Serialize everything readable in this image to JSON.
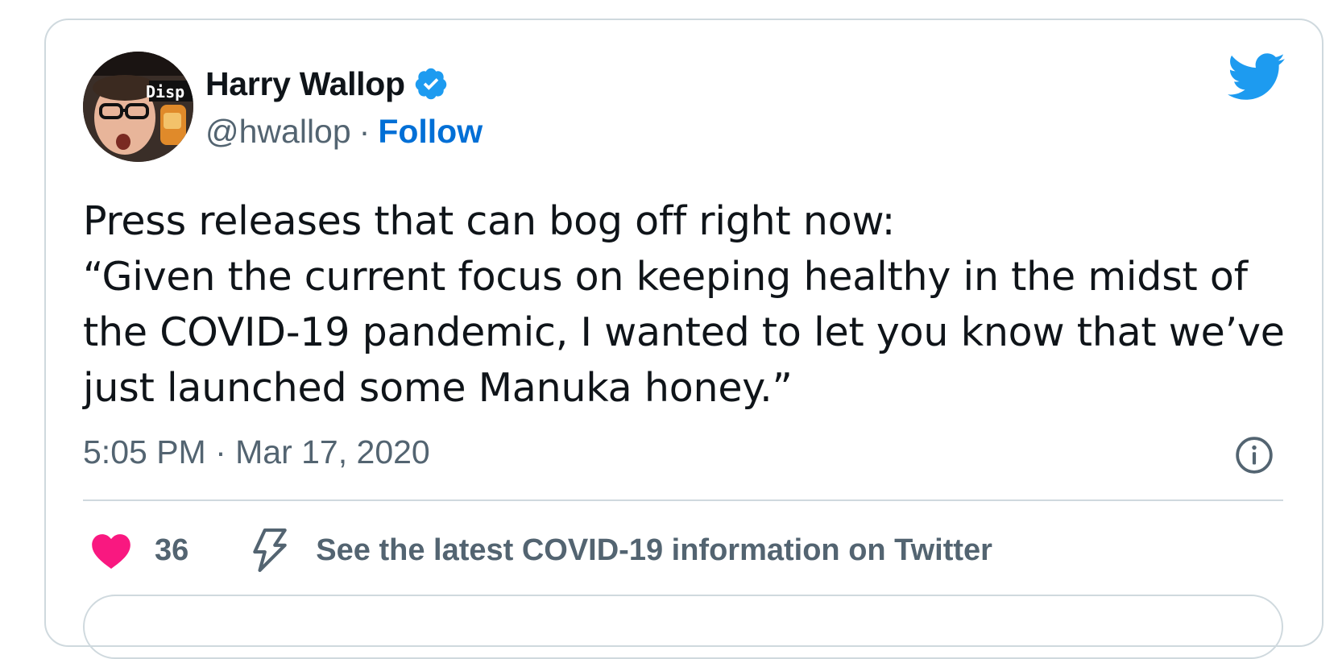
{
  "author": {
    "display_name": "Harry Wallop",
    "handle": "@hwallop",
    "separator": "·",
    "follow_label": "Follow",
    "avatar_badge_text": "Disp",
    "verified_icon": "verified-badge-icon"
  },
  "tweet": {
    "text": "Press releases that can bog off right now:\n“Given the current focus on keeping healthy in the midst of the COVID-19 pandemic, I wanted to let you know that we’ve just launched some Manuka honey.”",
    "timestamp": "5:05 PM · Mar 17, 2020"
  },
  "actions": {
    "like_count": "36",
    "covid_info_label": "See the latest COVID-19 information on Twitter"
  },
  "icons": {
    "logo": "twitter-bird-icon",
    "info": "info-icon",
    "like": "heart-icon",
    "covid": "lightning-bolt-icon"
  },
  "colors": {
    "twitter_blue": "#1d9bf0",
    "follow_blue": "#006fd6",
    "like_pink": "#f91880",
    "secondary_text": "#536471",
    "primary_text": "#0f1419",
    "border": "#cfd9de"
  }
}
